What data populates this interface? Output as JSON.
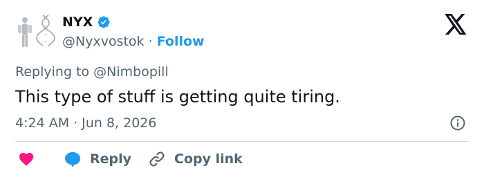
{
  "author": {
    "name": "NYX",
    "handle": "@Nyxvostok",
    "separator": "·",
    "follow_label": "Follow",
    "verified": true
  },
  "tweet": {
    "replying_to": "Replying to @Nimbopill",
    "text": "This type of stuff is getting quite tiring.",
    "timestamp": "4:24 AM · Jun 8, 2026"
  },
  "actions": {
    "reply_label": "Reply",
    "copy_link_label": "Copy link"
  },
  "icons": {
    "brand": "x-logo-icon",
    "verified": "verified-badge-icon",
    "info": "info-icon",
    "like": "heart-icon",
    "reply": "reply-bubble-icon",
    "copy": "link-icon"
  },
  "colors": {
    "text": "#0f1419",
    "muted": "#536471",
    "accent": "#1d9bf0",
    "like": "#f91880",
    "divider": "#cfd9de"
  }
}
